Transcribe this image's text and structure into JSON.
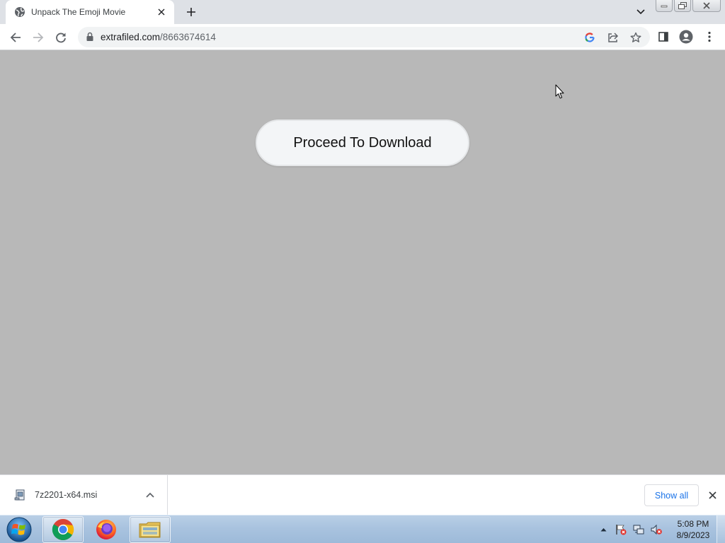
{
  "browser": {
    "tab": {
      "title": "Unpack The Emoji Movie",
      "favicon": "globe-icon"
    },
    "address": {
      "domain": "extrafiled.com",
      "path": "/8663674614"
    }
  },
  "page": {
    "background": "#b8b8b8",
    "proceed_label": "Proceed To Download"
  },
  "downloads": {
    "file_name": "7z2201-x64.msi",
    "show_all_label": "Show all"
  },
  "taskbar": {
    "apps": [
      "chrome-icon",
      "firefox-icon",
      "file-explorer-icon"
    ],
    "time": "5:08 PM",
    "date": "8/9/2023"
  },
  "colors": {
    "accent": "#1a73e8",
    "taskbar": "#a9c3df"
  }
}
